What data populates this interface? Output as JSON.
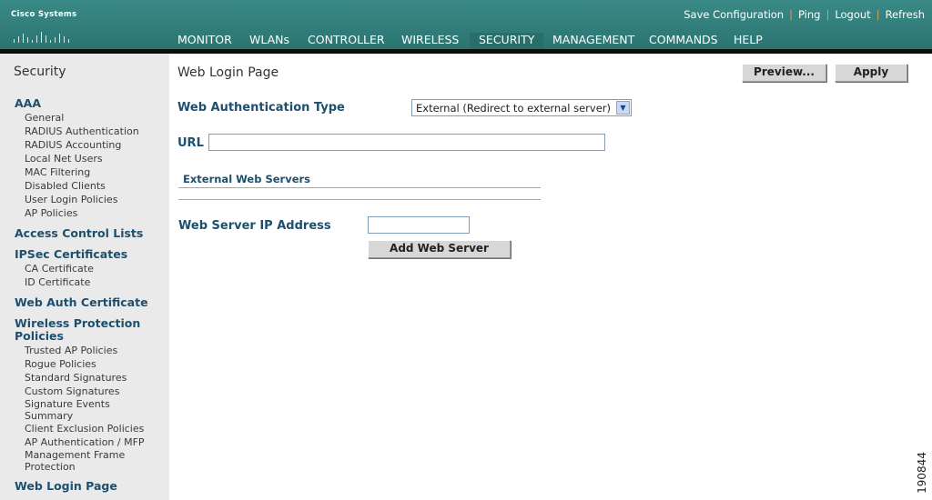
{
  "header": {
    "logo_text": "Cisco Systems",
    "util_links": [
      "Save Configuration",
      "Ping",
      "Logout",
      "Refresh"
    ],
    "nav": [
      {
        "label": "MONITOR"
      },
      {
        "label": "WLANs"
      },
      {
        "label": "CONTROLLER"
      },
      {
        "label": "WIRELESS"
      },
      {
        "label": "SECURITY"
      },
      {
        "label": "MANAGEMENT"
      },
      {
        "label": "COMMANDS"
      },
      {
        "label": "HELP"
      }
    ],
    "active_nav": "SECURITY"
  },
  "sidebar": {
    "title": "Security",
    "aaa": "AAA",
    "aaa_items": [
      "General",
      "RADIUS Authentication",
      "RADIUS Accounting",
      "Local Net Users",
      "MAC Filtering",
      "Disabled Clients",
      "User Login Policies",
      "AP Policies"
    ],
    "acl": "Access Control Lists",
    "ipsec": "IPSec Certificates",
    "ipsec_items": [
      "CA Certificate",
      "ID Certificate"
    ],
    "webauth_cert": "Web Auth Certificate",
    "wireless_protection_line1": "Wireless Protection",
    "wireless_protection_line2": "Policies",
    "wp_items": [
      "Trusted AP Policies",
      "Rogue Policies",
      "Standard Signatures",
      "Custom Signatures"
    ],
    "signature_events_line1": "Signature Events",
    "signature_events_line2": "Summary",
    "client_exclusion": "Client Exclusion Policies",
    "ap_auth": "AP Authentication / MFP",
    "mgmt_frame_line1": "Management Frame",
    "mgmt_frame_line2": "Protection",
    "web_login": "Web Login Page"
  },
  "main": {
    "title": "Web Login Page",
    "preview_label": "Preview...",
    "apply_label": "Apply",
    "auth_type_label": "Web Authentication Type",
    "auth_type_value": "External (Redirect to external server)",
    "url_label": "URL",
    "url_value": "",
    "ext_servers_label": "External Web Servers",
    "web_server_ip_label": "Web Server IP Address",
    "web_server_ip_value": "",
    "add_web_server_label": "Add Web Server"
  },
  "figure_id": "190844",
  "colors": {
    "header_teal": "#2f7c7a",
    "active_tab_underline": "#f0a020",
    "sidebar_bg": "#eaeaea",
    "label_blue": "#1d4f6e"
  }
}
